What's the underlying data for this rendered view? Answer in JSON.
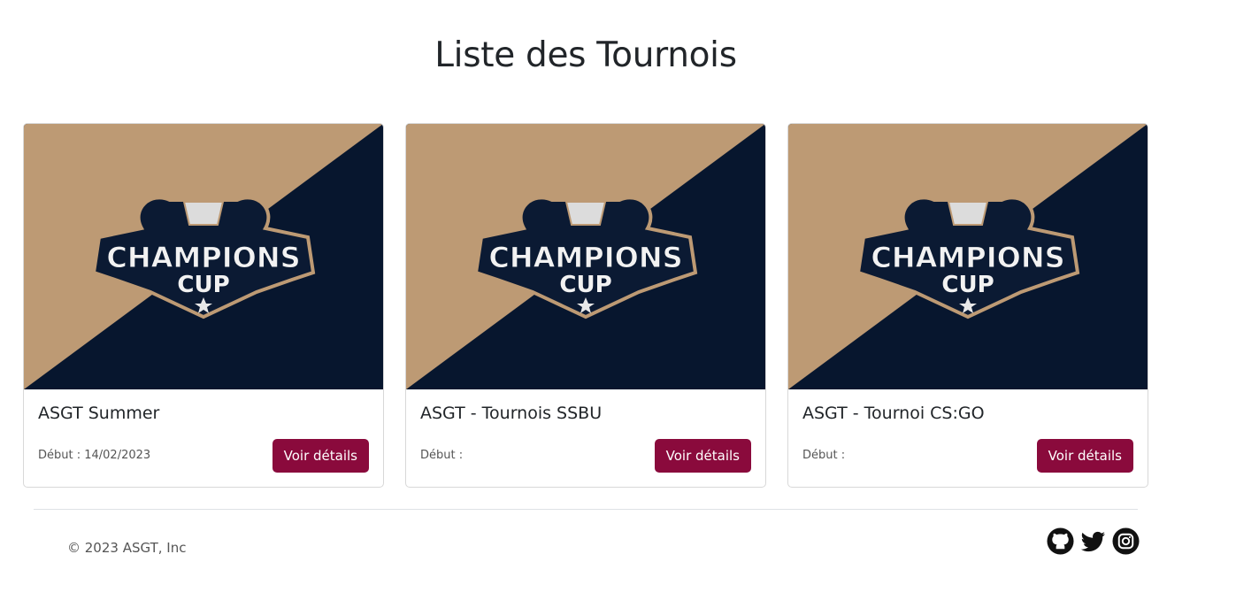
{
  "page": {
    "title": "Liste des Tournois"
  },
  "colors": {
    "accent": "#8a0a3c",
    "banner_tan": "#bd9a74",
    "banner_navy": "#07162e"
  },
  "banner": {
    "line1": "CHAMPIONS",
    "line2": "CUP"
  },
  "tournaments": [
    {
      "name": "ASGT Summer",
      "start_label": "Début : 14/02/2023",
      "button": "Voir détails"
    },
    {
      "name": "ASGT - Tournois SSBU",
      "start_label": "Début :",
      "button": "Voir détails"
    },
    {
      "name": "ASGT - Tournoi CS:GO",
      "start_label": "Début :",
      "button": "Voir détails"
    }
  ],
  "footer": {
    "copyright": "© 2023 ASGT, Inc",
    "social": [
      {
        "icon": "github-icon"
      },
      {
        "icon": "twitter-icon"
      },
      {
        "icon": "instagram-icon"
      }
    ]
  }
}
